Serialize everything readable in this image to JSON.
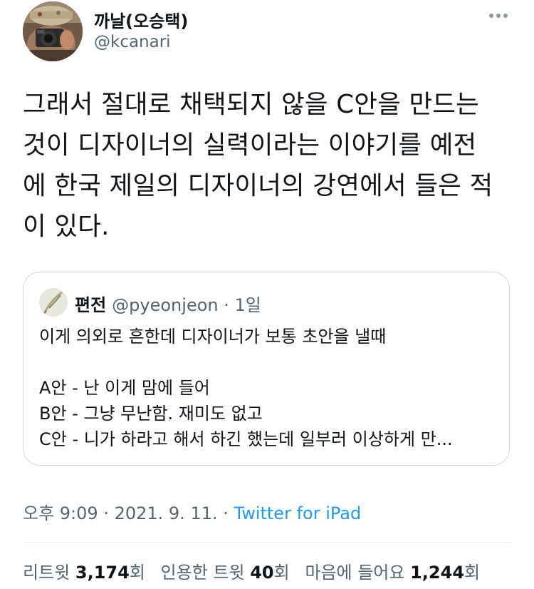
{
  "author": {
    "name": "까날(오승택)",
    "handle": "@kcanari",
    "avatar_icon": "camera-photographer-avatar"
  },
  "more_icon": "more-horizontal-icon",
  "tweet": {
    "lines": [
      "그래서 절대로 채택되지 않을 C안을 만드는",
      "것이 디자이너의 실력이라는 이야기를 예전",
      "에 한국 제일의 디자이너의 강연에서 들은 적",
      "이 있다."
    ]
  },
  "quote": {
    "name": "편전",
    "handle": "@pyeonjeon",
    "separator": " · ",
    "time": "1일",
    "avatar_icon": "feather-avatar",
    "lines": [
      "이게 의외로 흔한데 디자이너가 보통 초안을 낼때",
      "",
      "A안 - 난 이게 맘에 들어",
      "B안 - 그냥 무난함. 재미도 없고",
      "C안 - 니가 하라고 해서 하긴 했는데 일부러 이상하게 만..."
    ]
  },
  "meta": {
    "time": "오후 9:09",
    "sep1": " · ",
    "date": "2021. 9. 11.",
    "sep2": " · ",
    "source": "Twitter for iPad"
  },
  "stats": {
    "retweets_label": "리트윗",
    "retweets_count": "3,174",
    "retweets_unit": "회",
    "quotes_label": "인용한 트윗",
    "quotes_count": "40",
    "quotes_unit": "회",
    "likes_label": "마음에 들어요",
    "likes_count": "1,244",
    "likes_unit": "회"
  },
  "colors": {
    "text": "#0f1419",
    "secondary": "#536471",
    "link": "#1d9bf0",
    "border": "#cfd9de"
  }
}
